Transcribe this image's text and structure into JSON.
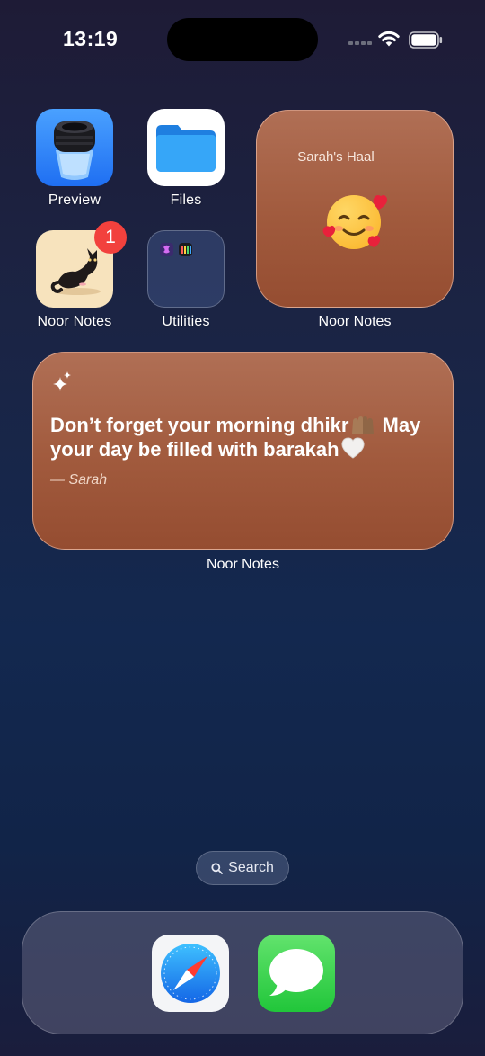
{
  "status_bar": {
    "time": "13:19"
  },
  "home_screen": {
    "apps": [
      {
        "label": "Preview",
        "icon": "preview-icon"
      },
      {
        "label": "Files",
        "icon": "files-folder-icon"
      },
      {
        "label": "Noor Notes",
        "icon": "black-cat-icon",
        "badge": "1"
      },
      {
        "label": "Utilities",
        "icon": "folder-icon"
      }
    ],
    "haal_widget": {
      "title": "Sarah's Haal",
      "mood_icon": "smiling-face-with-hearts-emoji",
      "caption": "Noor Notes"
    },
    "quote_widget": {
      "icon": "sparkles-icon",
      "text_part1": "Don’t forget your morning dhikr",
      "text_part2": " May your day be filled with barakah",
      "author": "— Sarah",
      "caption": "Noor Notes"
    },
    "search": {
      "label": "Search"
    }
  },
  "dock": {
    "apps": [
      {
        "name": "Safari",
        "icon": "compass-icon"
      },
      {
        "name": "Messages",
        "icon": "speech-bubble-icon"
      }
    ]
  },
  "colors": {
    "widget_brown": "#a15a3d",
    "badge_red": "#f2413d",
    "files_blue": "#2f9cf0",
    "messages_green": "#21c63a"
  }
}
